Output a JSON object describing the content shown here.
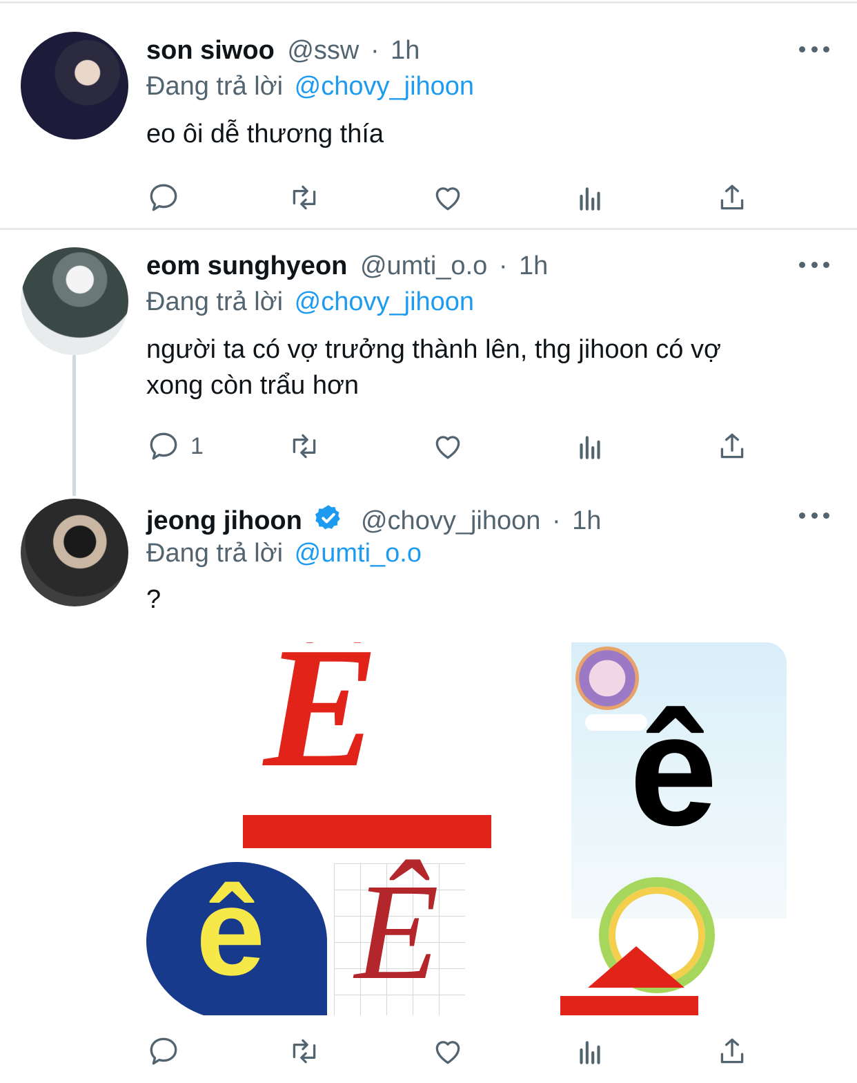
{
  "tweets": [
    {
      "name": "son siwoo",
      "handle": "@ssw",
      "time": "1h",
      "replying_prefix": "Đang trả lời",
      "replying_to": "@chovy_jihoon",
      "text": "eo ôi dễ thương thía",
      "reply_count": ""
    },
    {
      "name": "eom sunghyeon",
      "handle": "@umti_o.o",
      "time": "1h",
      "replying_prefix": "Đang trả lời",
      "replying_to": "@chovy_jihoon",
      "text_line1": "người ta có vợ trưởng thành lên, thg jihoon có vợ",
      "text_line2": "xong còn trẩu hơn",
      "reply_count": "1"
    },
    {
      "name": "jeong jihoon",
      "handle": "@chovy_jihoon",
      "time": "1h",
      "verified": true,
      "replying_prefix": "Đang trả lời",
      "replying_to": "@umti_o.o",
      "text": "?",
      "reply_count": "",
      "media": {
        "letter_big_upper": "Ê",
        "letter_lower": "ê",
        "script_letter": "Ê",
        "bubble_letter": "ê"
      }
    }
  ],
  "separator": "·",
  "colors": {
    "link": "#1d9bf0",
    "secondary_text": "#536471",
    "divider": "#e6e8ea",
    "thread_line": "#cfd9de",
    "red_letter": "#e2231a",
    "bubble_blue": "#183a8c",
    "bubble_yellow": "#f7e84a"
  },
  "icons": [
    "reply-icon",
    "retweet-icon",
    "like-icon",
    "analytics-icon",
    "share-icon",
    "more-icon",
    "verified-icon"
  ]
}
